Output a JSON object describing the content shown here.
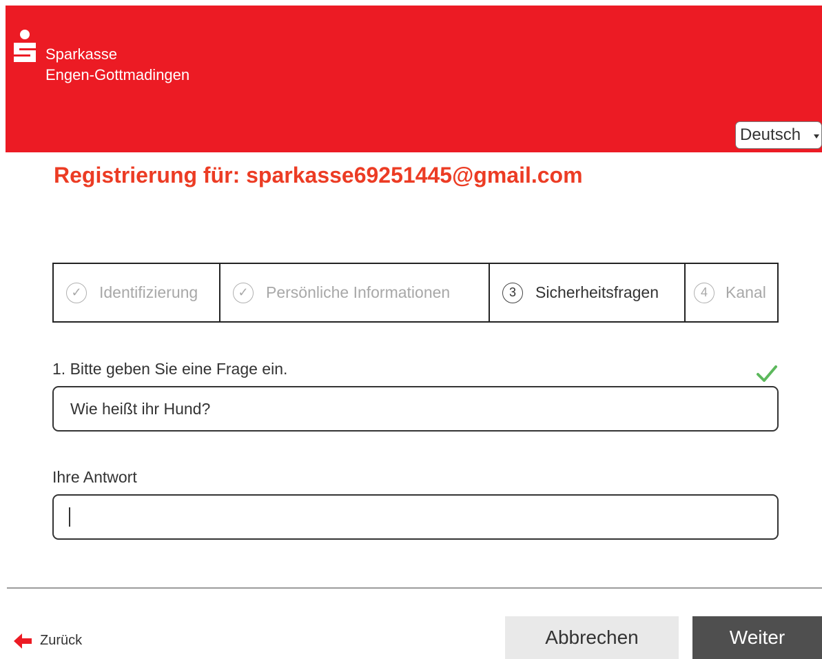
{
  "header": {
    "brand_line1": "Sparkasse",
    "brand_line2": "Engen-Gottmadingen",
    "language": "Deutsch",
    "brand_color": "#ec1b24",
    "logo_icon": "sparkasse-s-logo-icon"
  },
  "title": "Registrierung für: sparkasse69251445@gmail.com",
  "steps": [
    {
      "marker": "✓",
      "label": "Identifizierung",
      "state": "done"
    },
    {
      "marker": "✓",
      "label": "Persönliche Informationen",
      "state": "done"
    },
    {
      "marker": "3",
      "label": "Sicherheitsfragen",
      "state": "active"
    },
    {
      "marker": "4",
      "label": "Kanal",
      "state": "pending"
    }
  ],
  "question": {
    "label": "1. Bitte geben Sie eine Frage ein.",
    "value": "Wie heißt ihr Hund?",
    "valid_icon": "checkmark-icon"
  },
  "answer": {
    "label": "Ihre Antwort",
    "value": ""
  },
  "footer": {
    "back_label": "Zurück",
    "cancel_label": "Abbrechen",
    "next_label": "Weiter"
  }
}
